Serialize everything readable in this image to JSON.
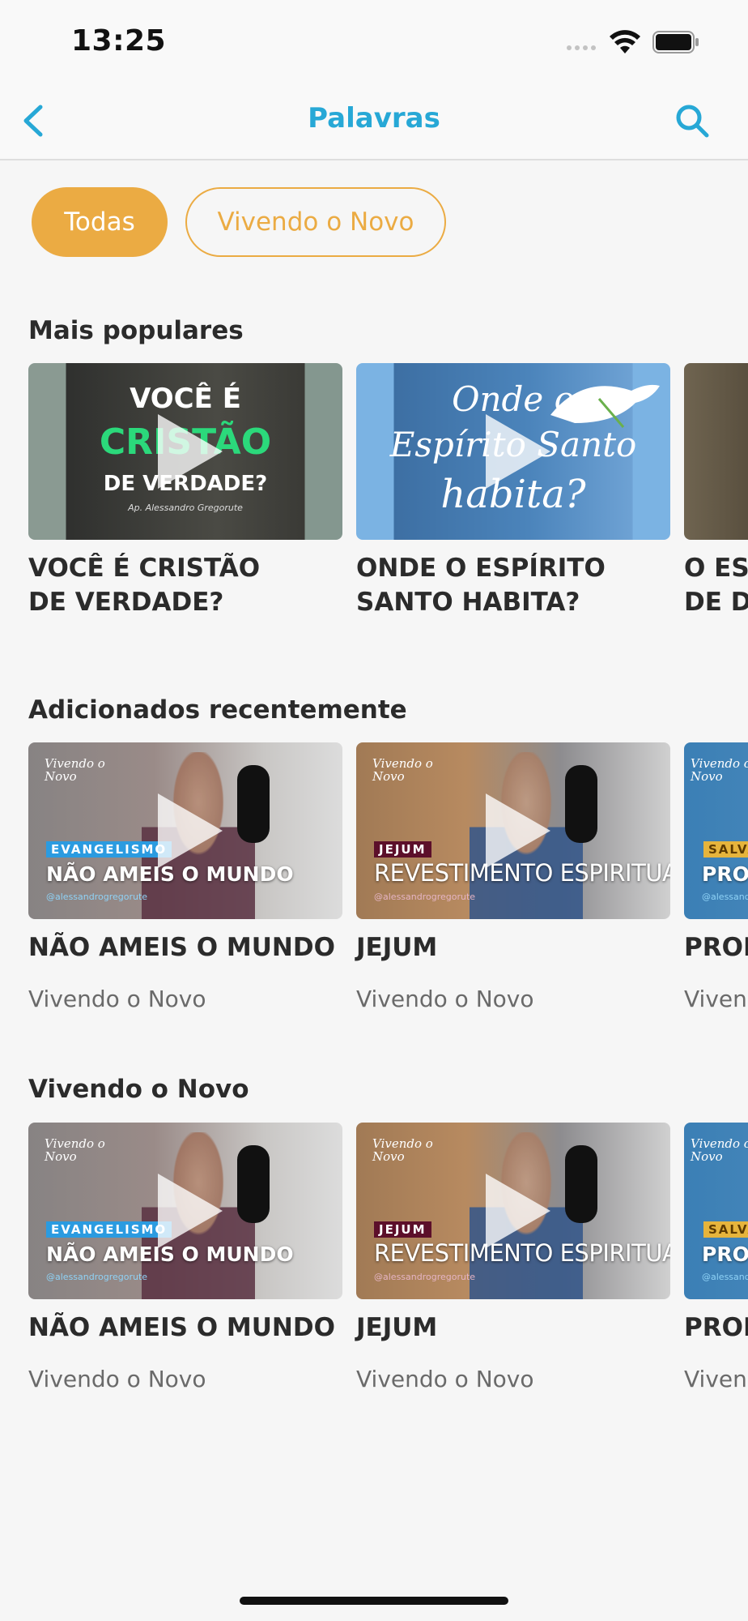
{
  "status_bar": {
    "time": "13:25"
  },
  "nav": {
    "title": "Palavras",
    "back_icon": "chevron-left-icon",
    "search_icon": "search-icon"
  },
  "filters": [
    {
      "label": "Todas",
      "selected": true
    },
    {
      "label": "Vivendo o Novo",
      "selected": false
    }
  ],
  "sections": {
    "popular": {
      "title": "Mais populares",
      "items": [
        {
          "title_line1": "VOCÊ É CRISTÃO",
          "title_line2": "DE VERDADE?",
          "thumb": {
            "line1": "VOCÊ É",
            "line2": "CRISTÃO",
            "line3": "DE VERDADE?",
            "line4": "Ap. Alessandro Gregorute"
          }
        },
        {
          "title_line1": "ONDE O ESPÍRITO",
          "title_line2": "SANTO HABITA?",
          "thumb": {
            "line1": "Onde o",
            "line2": "Espírito Santo",
            "line3": "habita?"
          }
        },
        {
          "title_line1": "O ES",
          "title_line2": "DE D"
        }
      ]
    },
    "recent": {
      "title": "Adicionados recentemente",
      "items": [
        {
          "title": "NÃO AMEIS O MUNDO",
          "subtitle": "Vivendo o Novo",
          "thumb": {
            "logo_line1": "Vivendo o",
            "logo_line2": "Novo",
            "tag": "EVANGELISMO",
            "headline": "NÃO AMEIS O MUNDO",
            "handle": "@alessandrogregorute"
          }
        },
        {
          "title": "JEJUM",
          "subtitle": "Vivendo o Novo",
          "thumb": {
            "logo_line1": "Vivendo o",
            "logo_line2": "Novo",
            "tag": "JEJUM",
            "headline": "REVESTIMENTO ESPIRITUAL",
            "handle": "@alessandrogregorute"
          }
        },
        {
          "title": "PROM",
          "subtitle": "Vivend",
          "thumb": {
            "logo_line1": "Vivendo o",
            "logo_line2": "Novo",
            "tag": "SALVA",
            "headline": "PRO",
            "handle": "@alessandr"
          }
        }
      ]
    },
    "vivendo": {
      "title": "Vivendo o Novo",
      "items": [
        {
          "title": "NÃO AMEIS O MUNDO",
          "subtitle": "Vivendo o Novo",
          "thumb": {
            "logo_line1": "Vivendo o",
            "logo_line2": "Novo",
            "tag": "EVANGELISMO",
            "headline": "NÃO AMEIS O MUNDO",
            "handle": "@alessandrogregorute"
          }
        },
        {
          "title": "JEJUM",
          "subtitle": "Vivendo o Novo",
          "thumb": {
            "logo_line1": "Vivendo o",
            "logo_line2": "Novo",
            "tag": "JEJUM",
            "headline": "REVESTIMENTO ESPIRITUAL",
            "handle": "@alessandrogregorute"
          }
        },
        {
          "title": "PROM",
          "subtitle": "Vivend",
          "thumb": {
            "logo_line1": "Vivendo o",
            "logo_line2": "Novo",
            "tag": "SALVA",
            "headline": "PRO",
            "handle": "@alessandr"
          }
        }
      ]
    }
  },
  "colors": {
    "accent_blue": "#27a8d6",
    "accent_orange": "#ebab43",
    "background": "#f6f6f6"
  }
}
